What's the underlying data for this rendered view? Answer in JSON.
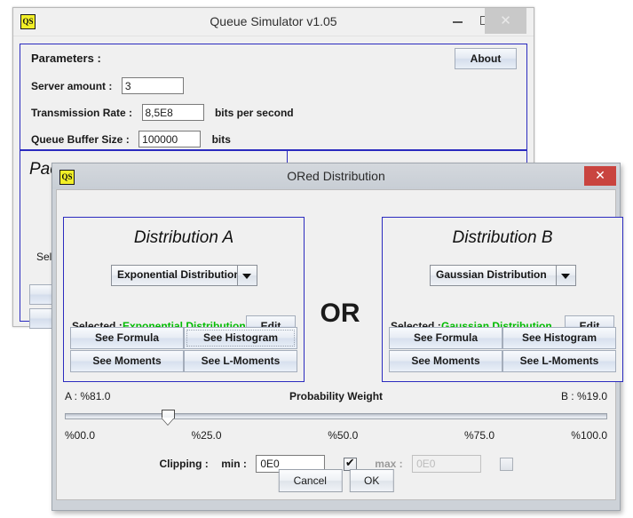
{
  "main_window": {
    "title": "Queue Simulator v1.05",
    "icon": "qs-app-icon",
    "minimize": "minimize-icon",
    "maximize": "maximize-icon",
    "close": "close-icon",
    "close_glyph": "✕",
    "params_title": "Parameters :",
    "about_label": "About",
    "rows": [
      {
        "label": "Server amount :",
        "value": "3",
        "unit": "",
        "field_width": 70
      },
      {
        "label": "Transmission Rate :",
        "value": "8,5E8",
        "unit": "bits per second",
        "field_width": 70
      },
      {
        "label": "Queue Buffer Size :",
        "value": "100000",
        "unit": "bits",
        "field_width": 70
      }
    ],
    "packet_panel_title": "Pac",
    "packet_selected_label": "Sel"
  },
  "dialog": {
    "title": "ORed Distribution",
    "icon": "qs-app-icon",
    "close_glyph": "✕",
    "or_text": "OR",
    "distribution_a": {
      "heading": "Distribution A",
      "combo_value": "Exponential Distribution",
      "selected_label": "Selected :",
      "selected_value": "Exponential Distribution",
      "edit_label": "Edit",
      "buttons": [
        "See Formula",
        "See Histogram",
        "See Moments",
        "See L-Moments"
      ],
      "focused_button_index": 1
    },
    "distribution_b": {
      "heading": "Distribution B",
      "combo_value": "Gaussian Distribution",
      "selected_label": "Selected :",
      "selected_value": "Gaussian Distribution",
      "edit_label": "Edit",
      "buttons": [
        "See Formula",
        "See Histogram",
        "See Moments",
        "See L-Moments"
      ],
      "focused_button_index": -1
    },
    "slider": {
      "title": "Probability Weight",
      "left_label": "A : %81.0",
      "right_label": "B : %19.0",
      "value_percent": 19.0,
      "ticks": [
        "%00.0",
        "%25.0",
        "%50.0",
        "%75.0",
        "%100.0"
      ]
    },
    "clipping": {
      "label": "Clipping :",
      "min_label": "min :",
      "min_value": "0E0",
      "min_enabled": true,
      "min_checkbox_checked": true,
      "max_label": "max :",
      "max_value": "0E0",
      "max_enabled": false,
      "max_checkbox_checked": false
    },
    "footer": {
      "cancel_label": "Cancel",
      "ok_label": "OK"
    }
  },
  "colors": {
    "panel_border": "#2b2bbf",
    "selected_green": "#00bb00",
    "close_red": "#c9443f",
    "dialog_chrome": "#cdd2d8"
  }
}
